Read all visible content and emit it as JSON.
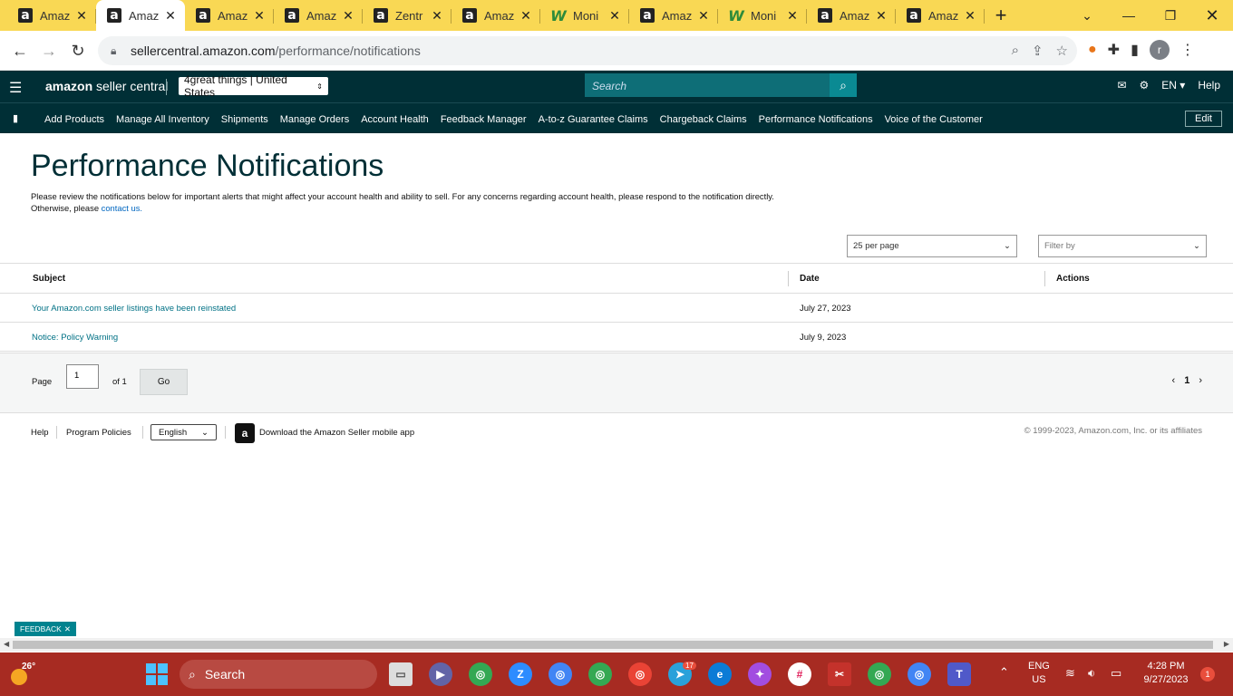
{
  "browser": {
    "tabs": [
      {
        "title": "Amaz",
        "icon": "amazon-icon",
        "active": false
      },
      {
        "title": "Amaz",
        "icon": "amazon-icon",
        "active": true
      },
      {
        "title": "Amaz",
        "icon": "amazon-icon",
        "active": false
      },
      {
        "title": "Amaz",
        "icon": "amazon-icon",
        "active": false
      },
      {
        "title": "Zentr",
        "icon": "amazon-icon",
        "active": false
      },
      {
        "title": "Amaz",
        "icon": "amazon-icon",
        "active": false
      },
      {
        "title": "Moni",
        "icon": "monitor-icon",
        "active": false
      },
      {
        "title": "Amaz",
        "icon": "amazon-icon",
        "active": false
      },
      {
        "title": "Moni",
        "icon": "monitor-icon",
        "active": false
      },
      {
        "title": "Amaz",
        "icon": "amazon-icon",
        "active": false
      },
      {
        "title": "Amaz",
        "icon": "amazon-icon",
        "active": false
      }
    ],
    "url_host": "sellercentral.amazon.com",
    "url_path": "/performance/notifications",
    "profile_initial": "r"
  },
  "header": {
    "logo_bold": "amazon",
    "logo_rest": " seller central",
    "store": "4great things | United States",
    "search_placeholder": "Search",
    "language": "EN",
    "help": "Help"
  },
  "bookmarks": {
    "items": [
      "Add Products",
      "Manage All Inventory",
      "Shipments",
      "Manage Orders",
      "Account Health",
      "Feedback Manager",
      "A-to-z Guarantee Claims",
      "Chargeback Claims",
      "Performance Notifications",
      "Voice of the Customer"
    ],
    "edit": "Edit"
  },
  "page": {
    "title": "Performance Notifications",
    "desc1": "Please review the notifications below for important alerts that might affect your account health and ability to sell. For any concerns regarding account health, please respond to the notification directly.",
    "desc2_prefix": "Otherwise, please ",
    "desc2_link": "contact us.",
    "per_page": "25 per page",
    "filter": "Filter by"
  },
  "table": {
    "headers": {
      "subject": "Subject",
      "date": "Date",
      "actions": "Actions"
    },
    "rows": [
      {
        "subject": "Your Amazon.com seller listings have been reinstated",
        "date": "July 27, 2023"
      },
      {
        "subject": "Notice: Policy Warning",
        "date": "July 9, 2023"
      }
    ]
  },
  "pager": {
    "label": "Page",
    "value": "1",
    "of": "of 1",
    "go": "Go",
    "current": "1"
  },
  "footer": {
    "help": "Help",
    "policies": "Program Policies",
    "language": "English",
    "app": "Download the Amazon Seller mobile app",
    "copyright": "© 1999-2023, Amazon.com, Inc. or its affiliates"
  },
  "feedback": "FEEDBACK",
  "taskbar": {
    "temp": "26°",
    "search": "Search",
    "telegram_badge": "17",
    "lang1": "ENG",
    "lang2": "US",
    "time": "4:28 PM",
    "date": "9/27/2023",
    "notif_count": "1"
  },
  "colors": {
    "header_bg": "#002f36",
    "tab_bar": "#f9d854",
    "taskbar": "#a72b22",
    "link": "#007185"
  }
}
